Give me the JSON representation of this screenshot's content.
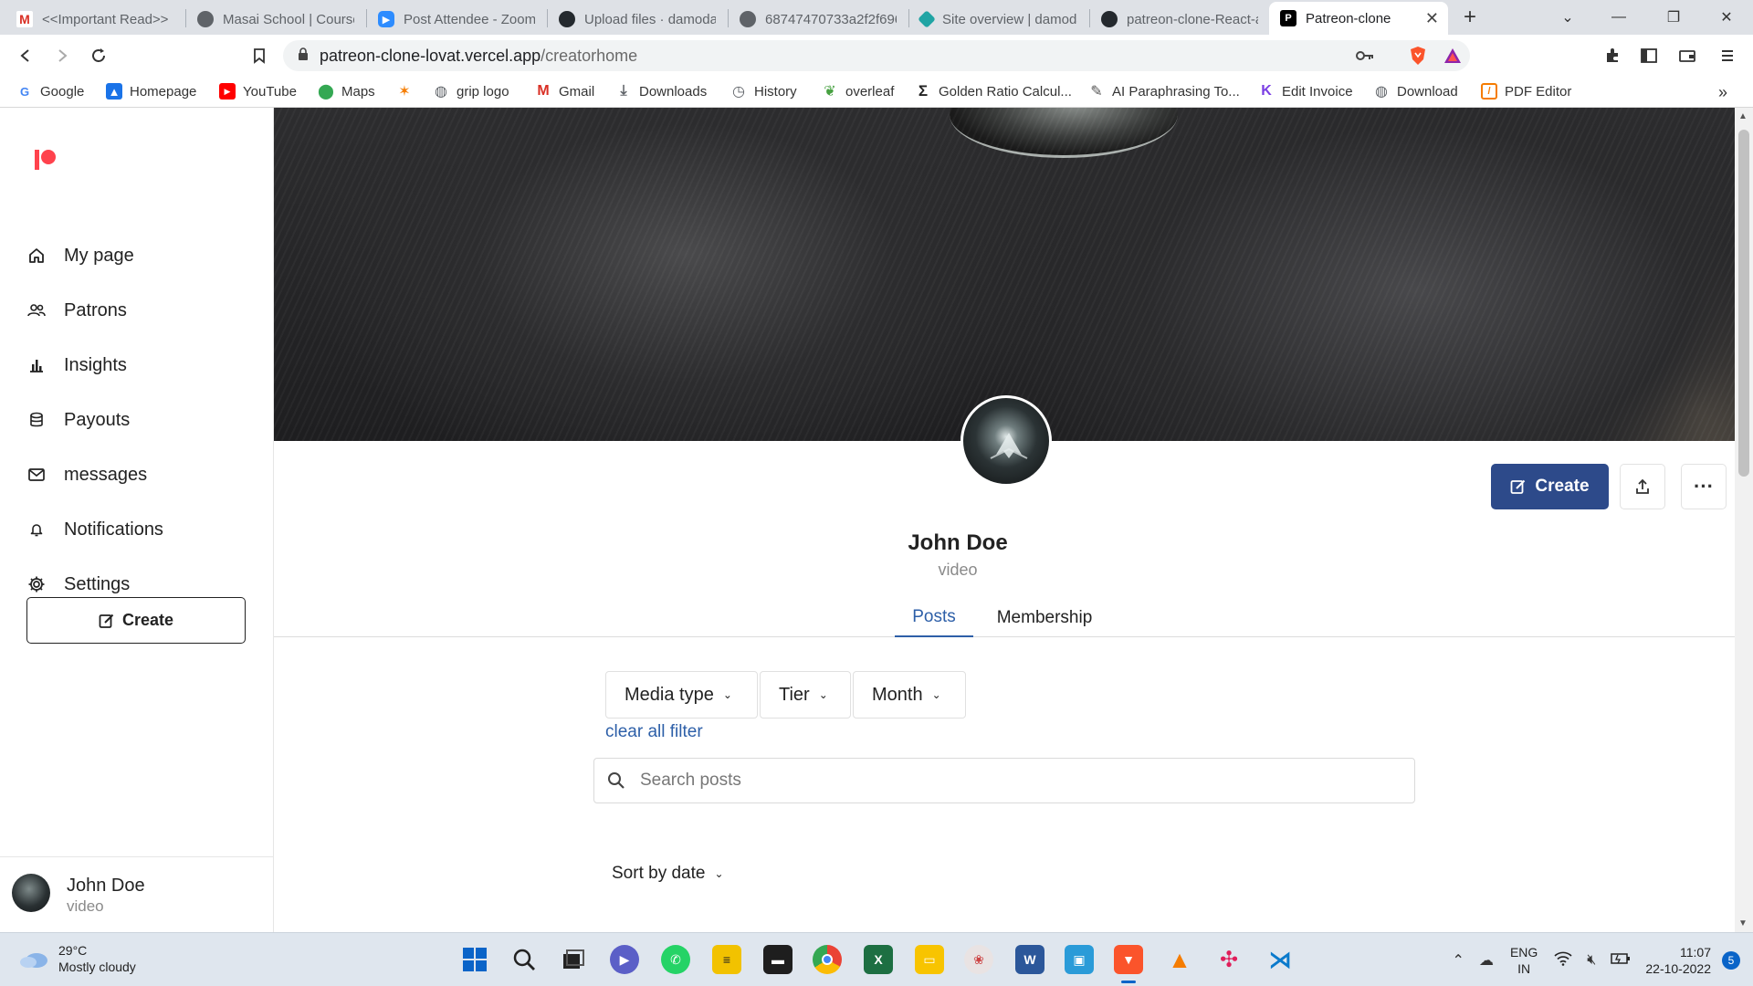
{
  "browser": {
    "tabs": [
      {
        "label": "<<Important Read>>",
        "icon": "gmail-icon",
        "color": "#d93025"
      },
      {
        "label": "Masai School | Course",
        "icon": "globe-icon",
        "color": "#5f6368"
      },
      {
        "label": "Post Attendee - Zoom",
        "icon": "zoom-icon",
        "color": "#2d8cff"
      },
      {
        "label": "Upload files · damodar",
        "icon": "github-icon",
        "color": "#24292e"
      },
      {
        "label": "68747470733a2f2f696",
        "icon": "globe-icon",
        "color": "#5f6368"
      },
      {
        "label": "Site overview | damoda",
        "icon": "netlify-icon",
        "color": "#20a4a4"
      },
      {
        "label": "patreon-clone-React-a",
        "icon": "github-icon",
        "color": "#24292e"
      },
      {
        "label": "Patreon-clone",
        "icon": "patreon-icon",
        "color": "#000000"
      }
    ],
    "new_tab_label": "+",
    "url_host": "patreon-clone-lovat.vercel.app",
    "url_path": "/creatorhome",
    "bookmarks": [
      {
        "label": "Google",
        "icon": "google-icon",
        "color": "#4285f4"
      },
      {
        "label": "Homepage",
        "icon": "homepage-icon",
        "color": "#1a73e8"
      },
      {
        "label": "YouTube",
        "icon": "youtube-icon",
        "color": "#ff0000"
      },
      {
        "label": "Maps",
        "icon": "maps-icon",
        "color": "#34a853"
      },
      {
        "label": "",
        "icon": "colorful-star-icon",
        "color": "#f57c00"
      },
      {
        "label": "grip logo",
        "icon": "globe-icon",
        "color": "#5f6368"
      },
      {
        "label": "Gmail",
        "icon": "gmail-icon",
        "color": "#d93025"
      },
      {
        "label": "Downloads",
        "icon": "download-icon",
        "color": "#5f6368"
      },
      {
        "label": "History",
        "icon": "history-icon",
        "color": "#5f6368"
      },
      {
        "label": "overleaf",
        "icon": "overleaf-icon",
        "color": "#47a141"
      },
      {
        "label": "Golden Ratio Calcul...",
        "icon": "sigma-icon",
        "color": "#222222"
      },
      {
        "label": "AI Paraphrasing To...",
        "icon": "quill-icon",
        "color": "#555555"
      },
      {
        "label": "Edit Invoice",
        "icon": "invoice-icon",
        "color": "#7b3fe4"
      },
      {
        "label": "Download",
        "icon": "globe-icon",
        "color": "#5f6368"
      },
      {
        "label": "PDF Editor",
        "icon": "pdf-editor-icon",
        "color": "#f57c00"
      }
    ],
    "more_bookmarks": "»"
  },
  "sidebar": {
    "items": [
      {
        "label": "My page",
        "icon": "home-icon"
      },
      {
        "label": "Patrons",
        "icon": "people-icon"
      },
      {
        "label": "Insights",
        "icon": "bar-chart-icon"
      },
      {
        "label": "Payouts",
        "icon": "coins-icon"
      },
      {
        "label": "messages",
        "icon": "mail-icon"
      },
      {
        "label": "Notifications",
        "icon": "bell-icon"
      },
      {
        "label": "Settings",
        "icon": "gear-icon"
      }
    ],
    "create_label": "Create",
    "user": {
      "name": "John Doe",
      "subtitle": "video"
    }
  },
  "profile": {
    "name": "John Doe",
    "category": "video",
    "create_label": "Create",
    "more_label": "···",
    "tabs": [
      "Posts",
      "Membership"
    ],
    "active_tab": "Posts"
  },
  "filters": {
    "items": [
      "Media type",
      "Tier",
      "Month"
    ],
    "clear_label": "clear all filter",
    "search_placeholder": "Search posts",
    "sort_label": "Sort by date"
  },
  "taskbar": {
    "weather_temp": "29°C",
    "weather_desc": "Mostly cloudy",
    "lang_top": "ENG",
    "lang_bottom": "IN",
    "time": "11:07",
    "date": "22-10-2022",
    "notification_count": "5"
  },
  "colors": {
    "accent": "#2d4a8a",
    "link": "#2d5fa8",
    "patreon_logo": "#ff424d"
  }
}
